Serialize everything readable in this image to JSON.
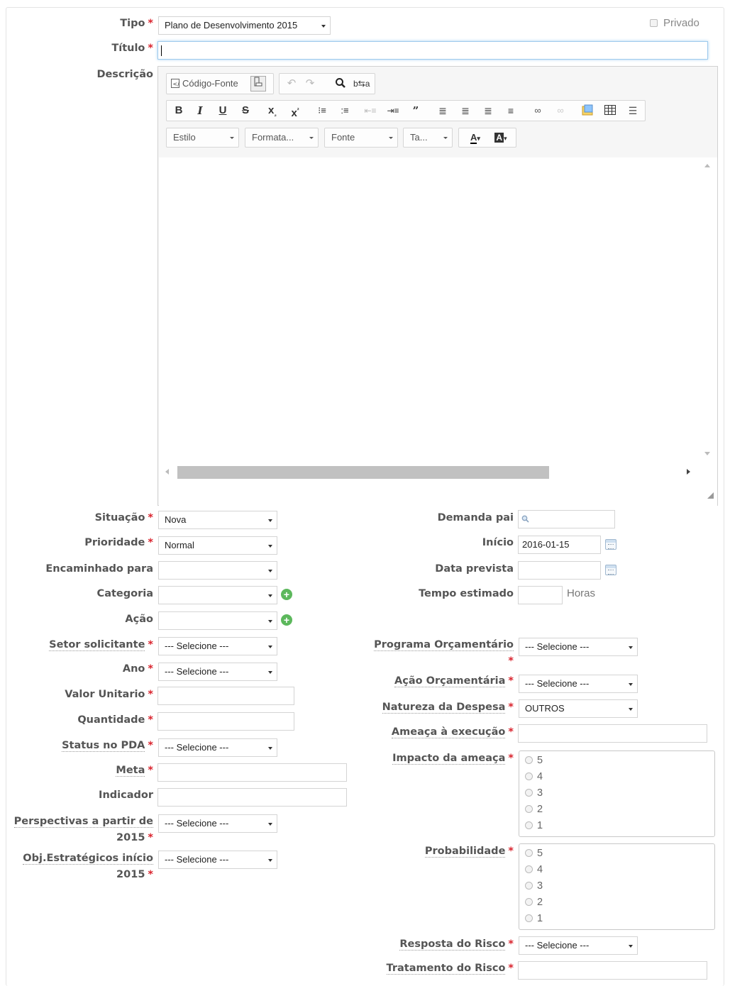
{
  "header": {
    "tipo_label": "Tipo",
    "tipo_value": "Plano de Desenvolvimento 2015",
    "privado_label": "Privado",
    "titulo_label": "Título",
    "titulo_value": ""
  },
  "editor": {
    "descricao_label": "Descrição",
    "source_button": "Código-Fonte",
    "combos": {
      "estilo": "Estilo",
      "formatacao": "Formata...",
      "fonte": "Fonte",
      "tamanho": "Ta..."
    }
  },
  "left_fields": {
    "situacao": {
      "label": "Situação",
      "value": "Nova"
    },
    "prioridade": {
      "label": "Prioridade",
      "value": "Normal"
    },
    "encaminhado": {
      "label": "Encaminhado para",
      "value": ""
    },
    "categoria": {
      "label": "Categoria",
      "value": ""
    },
    "acao": {
      "label": "Ação",
      "value": ""
    },
    "setor": {
      "label": "Setor solicitante",
      "value": "--- Selecione ---"
    },
    "ano": {
      "label": "Ano",
      "value": "--- Selecione ---"
    },
    "valor_unitario": {
      "label": "Valor Unitario",
      "value": ""
    },
    "quantidade": {
      "label": "Quantidade",
      "value": ""
    },
    "status_pda": {
      "label": "Status no PDA",
      "value": "--- Selecione ---"
    },
    "meta": {
      "label": "Meta",
      "value": ""
    },
    "indicador": {
      "label": "Indicador",
      "value": ""
    },
    "perspectivas": {
      "label_line1": "Perspectivas a partir de",
      "label_line2": "2015",
      "value": "--- Selecione ---"
    },
    "obj_estrategicos": {
      "label_line1": "Obj.Estratégicos início",
      "label_line2": "2015",
      "value": "--- Selecione ---"
    }
  },
  "right_fields": {
    "demanda_pai": {
      "label": "Demanda pai",
      "value": ""
    },
    "inicio": {
      "label": "Início",
      "value": "2016-01-15"
    },
    "data_prevista": {
      "label": "Data prevista",
      "value": ""
    },
    "tempo_estimado": {
      "label": "Tempo estimado",
      "value": "",
      "unit": "Horas"
    },
    "programa_orcamentario": {
      "label": "Programa Orçamentário",
      "value": "--- Selecione ---"
    },
    "acao_orcamentaria": {
      "label": "Ação Orçamentária",
      "value": "--- Selecione ---"
    },
    "natureza_despesa": {
      "label": "Natureza da Despesa",
      "value": "OUTROS"
    },
    "ameaca_execucao": {
      "label": "Ameaça à execução",
      "value": ""
    },
    "impacto_ameaca": {
      "label": "Impacto da ameaça",
      "options": [
        "5",
        "4",
        "3",
        "2",
        "1"
      ]
    },
    "probabilidade": {
      "label": "Probabilidade",
      "options": [
        "5",
        "4",
        "3",
        "2",
        "1"
      ]
    },
    "resposta_risco": {
      "label": "Resposta do Risco",
      "value": "--- Selecione ---"
    },
    "tratamento_risco": {
      "label": "Tratamento do Risco",
      "value": ""
    }
  },
  "required_marker": "*",
  "colors": {
    "required": "#d9232d",
    "add_icon": "#5cb85c",
    "focus_border": "#9ecaed"
  }
}
